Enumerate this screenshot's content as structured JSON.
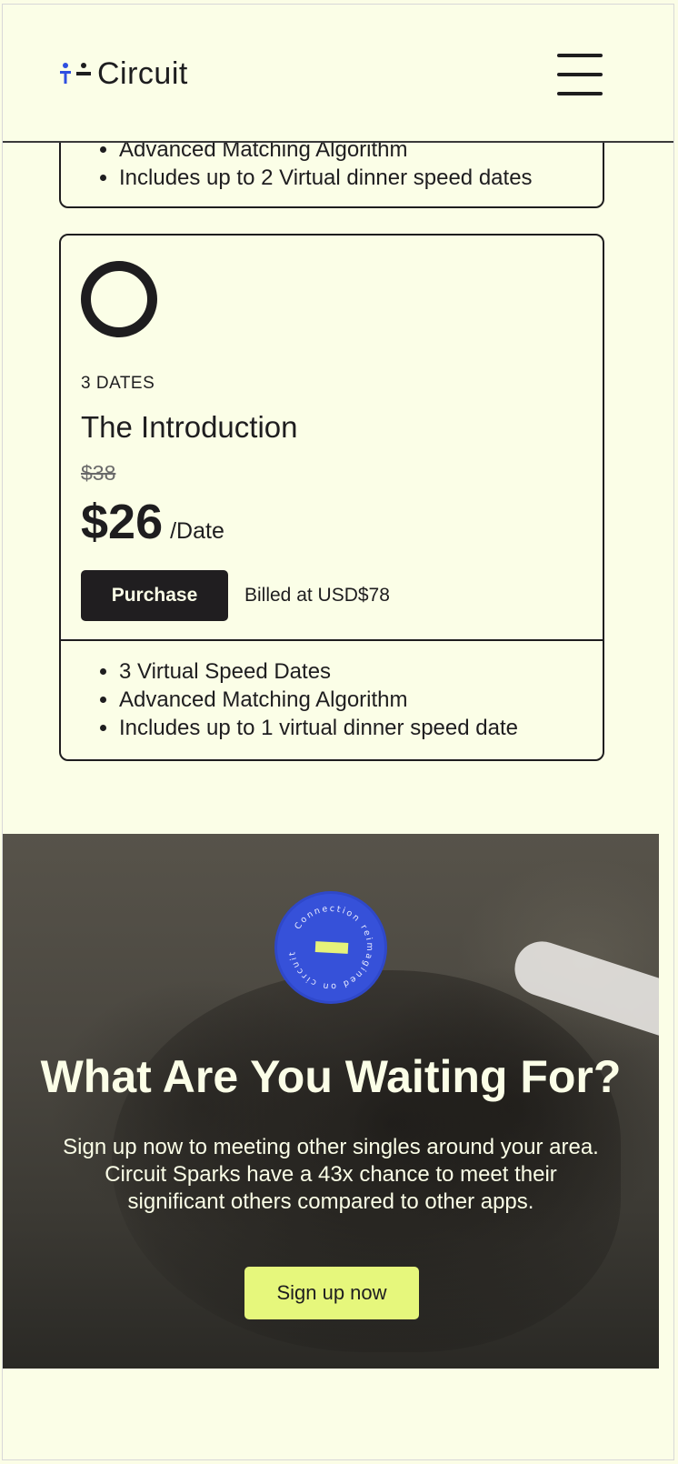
{
  "header": {
    "logo_text": "Circuit",
    "menu_icon": "hamburger-icon"
  },
  "previous_plan": {
    "features": [
      "Advanced Matching Algorithm",
      "Includes up to 2 Virtual dinner speed dates"
    ]
  },
  "plan": {
    "dates_label": "3 DATES",
    "title": "The Introduction",
    "old_price": "$38",
    "price": "$26",
    "per": "/Date",
    "purchase_label": "Purchase",
    "billed": "Billed at USD$78",
    "features": [
      "3 Virtual Speed Dates",
      "Advanced Matching Algorithm",
      "Includes up to 1 virtual dinner speed date"
    ]
  },
  "cta": {
    "badge_text": "Connection reimagined on circuit",
    "title": "What Are You Waiting For?",
    "text": "Sign up now to meeting other singles around your area. Circuit Sparks have a 43x chance to meet their significant others compared to other apps.",
    "button_label": "Sign up now"
  },
  "colors": {
    "background": "#fbfee7",
    "dark": "#1e1d1f",
    "accent_lime": "#e6f77c",
    "badge_blue": "#3651d9",
    "logo_blue": "#2f4fe0"
  }
}
